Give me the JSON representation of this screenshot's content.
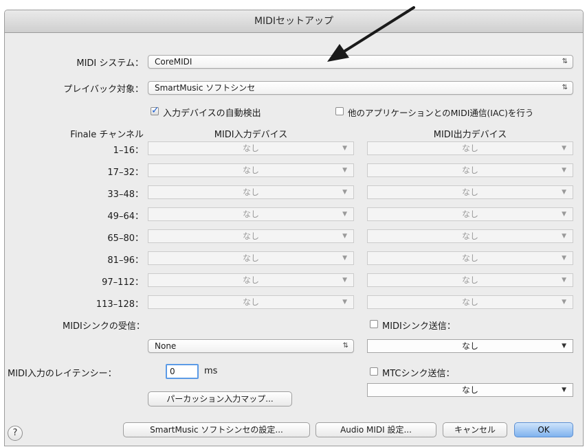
{
  "window": {
    "title": "MIDIセットアップ"
  },
  "midi_system": {
    "label": "MIDI システム：",
    "value": "CoreMIDI"
  },
  "playback": {
    "label": "プレイバック対象：",
    "value": "SmartMusic ソフトシンセ"
  },
  "auto_detect": {
    "label": "入力デバイスの自動検出",
    "checked": true
  },
  "iac": {
    "label": "他のアプリケーションとのMIDI通信(IAC)を行う",
    "checked": false
  },
  "columns": {
    "channel": "Finale チャンネル",
    "input": "MIDI入力デバイス",
    "output": "MIDI出力デバイス"
  },
  "channel_rows": [
    {
      "range": "1–16：",
      "input": "なし",
      "output": "なし"
    },
    {
      "range": "17–32：",
      "input": "なし",
      "output": "なし"
    },
    {
      "range": "33–48：",
      "input": "なし",
      "output": "なし"
    },
    {
      "range": "49–64：",
      "input": "なし",
      "output": "なし"
    },
    {
      "range": "65–80：",
      "input": "なし",
      "output": "なし"
    },
    {
      "range": "81–96：",
      "input": "なし",
      "output": "なし"
    },
    {
      "range": "97–112：",
      "input": "なし",
      "output": "なし"
    },
    {
      "range": "113–128：",
      "input": "なし",
      "output": "なし"
    }
  ],
  "sync_receive": {
    "label": "MIDIシンクの受信：",
    "value": "None"
  },
  "sync_send": {
    "label": "MIDIシンク送信：",
    "value": "なし",
    "checked": false
  },
  "mtc_send": {
    "label": "MTCシンク送信：",
    "value": "なし",
    "checked": false
  },
  "latency": {
    "label": "MIDI入力のレイテンシー：",
    "value": "0",
    "unit": "ms"
  },
  "percussion_button": "パーカッション入力マップ...",
  "buttons": {
    "help": "?",
    "smartmusic_settings": "SmartMusic ソフトシンセの設定...",
    "audio_midi": "Audio MIDI 設定...",
    "cancel": "キャンセル",
    "ok": "OK"
  }
}
